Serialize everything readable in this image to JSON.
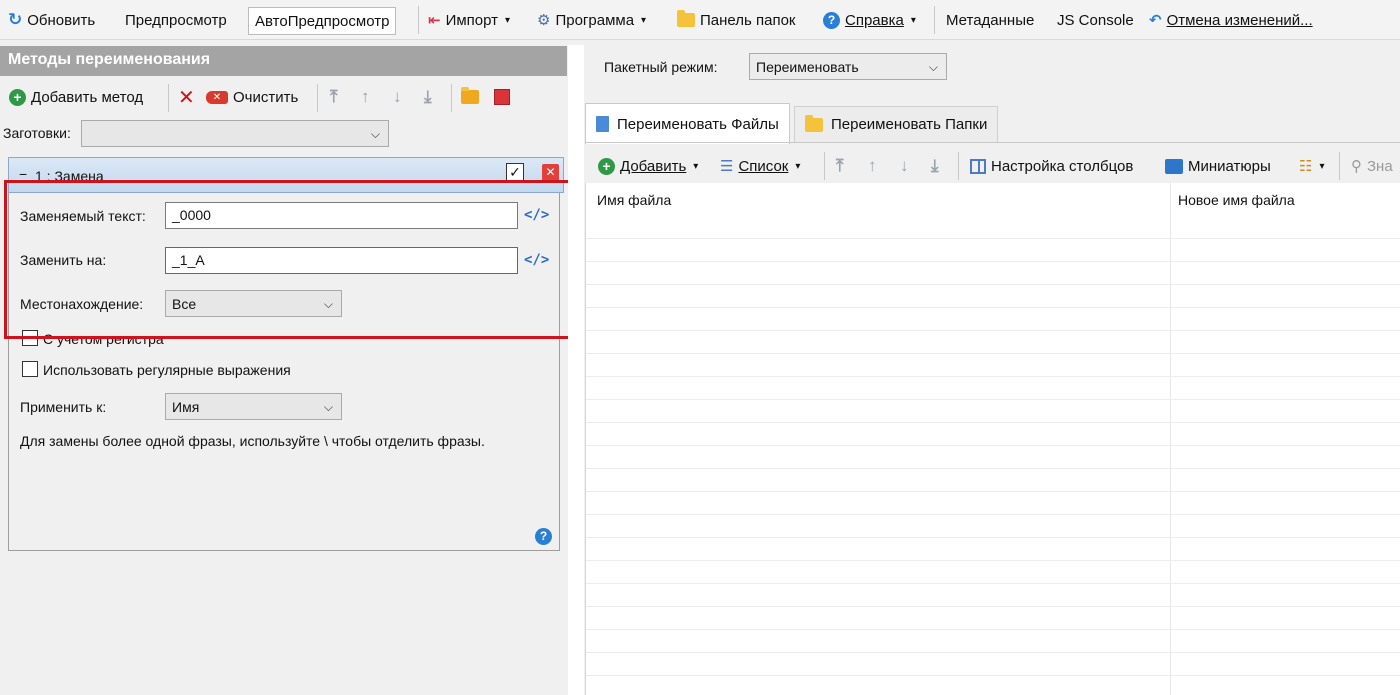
{
  "toolbar": {
    "refresh": "Обновить",
    "preview": "Предпросмотр",
    "autopreview": "АвтоПредпросмотр",
    "import": "Импорт",
    "program": "Программа",
    "folders_panel": "Панель папок",
    "help": "Справка",
    "metadata": "Метаданные",
    "js_console": "JS Console",
    "undo": "Отмена изменений..."
  },
  "methods_panel": {
    "title": "Методы переименования",
    "add_method": "Добавить метод",
    "clear": "Очистить",
    "presets_label": "Заготовки:",
    "presets_value": ""
  },
  "method": {
    "header": "1 : Замена",
    "find_label": "Заменяемый текст:",
    "find_value": "_0000",
    "replace_label": "Заменить на:",
    "replace_value": "_1_A",
    "location_label": "Местонахождение:",
    "location_value": "Все",
    "case_label": "С учетом регистра",
    "regex_label": "Использовать регулярные выражения",
    "apply_label": "Применить к:",
    "apply_value": "Имя",
    "hint": "Для замены более одной фразы, используйте \\ чтобы отделить фразы."
  },
  "right": {
    "batch_label": "Пакетный режим:",
    "batch_value": "Переименовать",
    "tab_files": "Переименовать Файлы",
    "tab_folders": "Переименовать Папки",
    "add": "Добавить",
    "list": "Список",
    "columns": "Настройка столбцов",
    "thumbnails": "Миниатюры",
    "cut_label": "Зна",
    "col_filename": "Имя файла",
    "col_newname": "Новое имя файла"
  },
  "colors": {
    "highlight_frame": "#d0121c",
    "panel_title_bg": "#a4a4a4",
    "accent_blue": "#2a7fd4"
  }
}
